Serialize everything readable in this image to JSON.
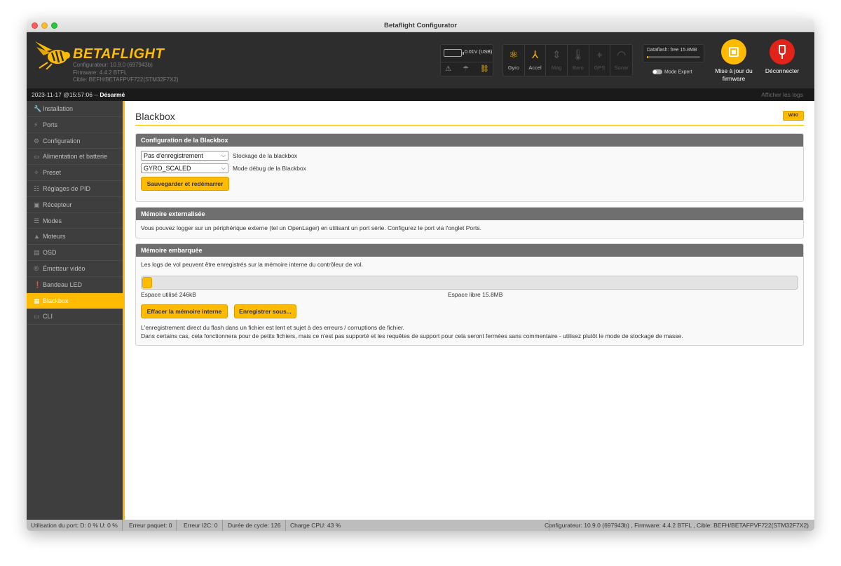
{
  "window": {
    "title": "Betaflight Configurator"
  },
  "header": {
    "logo_text": "BETAFLIGHT",
    "info_line1": "Configurateur: 10.9.0 (697943b)",
    "info_line2": "Firmware: 4.4.2 BTFL",
    "info_line3": "Cible: BEFH/BETAFPVF722(STM32F7X2)",
    "battery_value": "0.01V (USB)",
    "sensors": [
      {
        "label": "Gyro",
        "icon": "gyro-icon",
        "active": true
      },
      {
        "label": "Accel",
        "icon": "accel-icon",
        "active": true
      },
      {
        "label": "Mag",
        "icon": "mag-icon",
        "active": false
      },
      {
        "label": "Baro",
        "icon": "baro-icon",
        "active": false
      },
      {
        "label": "GPS",
        "icon": "gps-icon",
        "active": false
      },
      {
        "label": "Sonar",
        "icon": "sonar-icon",
        "active": false
      }
    ],
    "dataflash_label": "Dataflash: free 15.8MB",
    "dataflash_used_fraction": 0.02,
    "expert_mode_label": "Mode Expert",
    "firmware_button": "Mise à jour du firmware",
    "disconnect_button": "Déconnecter"
  },
  "status_strip": {
    "datetime": "2023-11-17 @15:57:06 -- ",
    "arm_state": "Désarmé",
    "show_logs": "Afficher les logs"
  },
  "sidebar": {
    "items": [
      {
        "label": "Installation",
        "icon": "wrench-icon"
      },
      {
        "label": "Ports",
        "icon": "plug-icon"
      },
      {
        "label": "Configuration",
        "icon": "gear-icon"
      },
      {
        "label": "Alimentation et batterie",
        "icon": "battery-icon"
      },
      {
        "label": "Preset",
        "icon": "wand-icon"
      },
      {
        "label": "Réglages de PID",
        "icon": "sliders-icon"
      },
      {
        "label": "Récepteur",
        "icon": "receiver-icon"
      },
      {
        "label": "Modes",
        "icon": "toggle-icon"
      },
      {
        "label": "Moteurs",
        "icon": "motor-icon"
      },
      {
        "label": "OSD",
        "icon": "osd-icon"
      },
      {
        "label": "Émetteur vidéo",
        "icon": "antenna-icon"
      },
      {
        "label": "Bandeau LED",
        "icon": "led-icon"
      },
      {
        "label": "Blackbox",
        "icon": "blackbox-icon",
        "active": true
      },
      {
        "label": "CLI",
        "icon": "terminal-icon"
      }
    ]
  },
  "main": {
    "title": "Blackbox",
    "wiki": "WIKI",
    "config": {
      "header": "Configuration de la Blackbox",
      "storage_value": "Pas d'enregistrement",
      "storage_label": "Stockage de la blackbox",
      "debug_value": "GYRO_SCALED",
      "debug_label": "Mode débug de la Blackbox",
      "save_button": "Sauvegarder et redémarrer"
    },
    "external": {
      "header": "Mémoire externalisée",
      "text": "Vous pouvez logger sur un périphérique externe (tel un OpenLager) en utilisant un port série. Configurez le port via l'onglet Ports."
    },
    "onboard": {
      "header": "Mémoire embarquée",
      "text": "Les logs de vol peuvent être enregistrés sur la mémoire interne du contrôleur de vol.",
      "used_fraction": 0.015,
      "used_label": "Espace utilisé 246kB",
      "free_label": "Espace libre 15.8MB",
      "erase_button": "Effacer la mémoire interne",
      "save_as_button": "Enregistrer sous...",
      "note1": "L'enregistrement direct du flash dans un fichier est lent et sujet à des erreurs / corruptions de fichier.",
      "note2": "Dans certains cas, cela fonctionnera pour de petits fichiers, mais ce n'est pas supporté et les requêtes de support pour cela seront fermées sans commentaire - utilisez plutôt le mode de stockage de masse."
    }
  },
  "bottom_bar": {
    "port_usage": "Utilisation du port: D: 0 % U: 0 %",
    "packet_error": "Erreur paquet: 0",
    "i2c_error": "Erreur I2C: 0",
    "cycle_time": "Durée de cycle: 126",
    "cpu_load": "Charge CPU: 43 %",
    "version_info": "Configurateur: 10.9.0 (697943b) , Firmware: 4.4.2 BTFL , Cible: BEFH/BETAFPVF722(STM32F7X2)"
  },
  "colors": {
    "accent": "#ffbb00",
    "header_bg": "#2d2d2d",
    "sidebar_bg": "#3e3e3e",
    "disconnect": "#e2231a",
    "box_header": "#6f6f6f"
  }
}
